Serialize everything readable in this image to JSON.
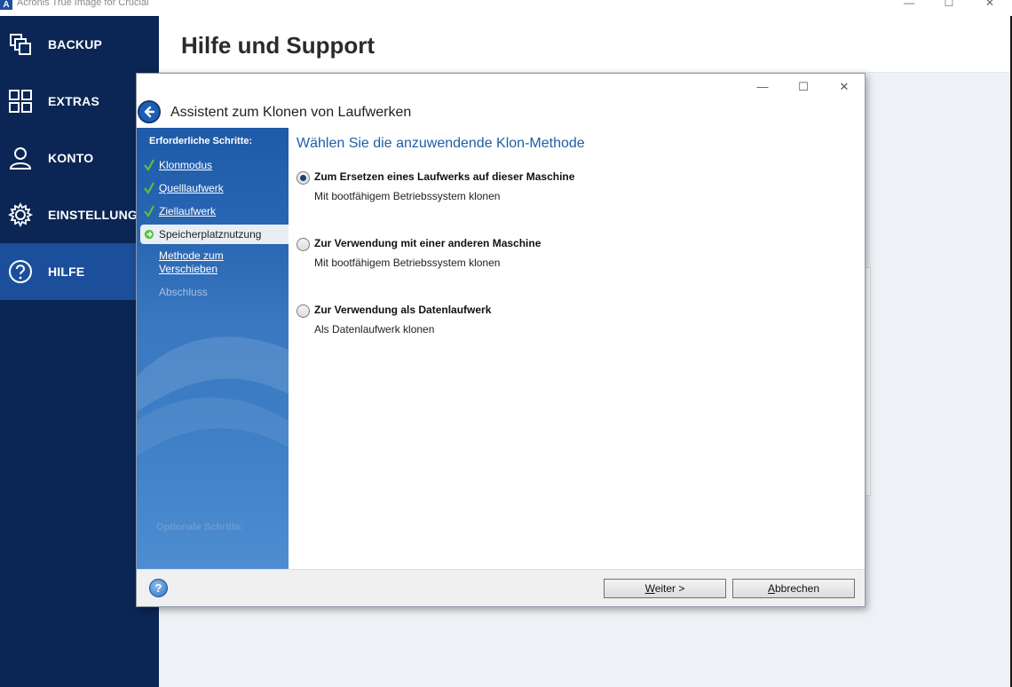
{
  "app": {
    "title": "Acronis True Image for Crucial",
    "logo_letter": "A",
    "controls": {
      "minimize": "—",
      "maximize": "☐",
      "close": "✕"
    }
  },
  "sidebar": {
    "items": [
      {
        "label": "BACKUP",
        "icon": "backup-icon",
        "active": false
      },
      {
        "label": "EXTRAS",
        "icon": "extras-grid-icon",
        "active": false
      },
      {
        "label": "KONTO",
        "icon": "user-icon",
        "active": false
      },
      {
        "label": "EINSTELLUNGEN",
        "icon": "gear-icon",
        "active": false
      },
      {
        "label": "HILFE",
        "icon": "help-icon",
        "active": true
      }
    ]
  },
  "main": {
    "title": "Hilfe und Support"
  },
  "wizard": {
    "title": "Assistent zum Klonen von Laufwerken",
    "controls": {
      "minimize": "—",
      "maximize": "☐",
      "close": "✕"
    },
    "steps_heading": "Erforderliche Schritte:",
    "steps": [
      {
        "label": "Klonmodus",
        "state": "done"
      },
      {
        "label": "Quelllaufwerk",
        "state": "done"
      },
      {
        "label": "Ziellaufwerk",
        "state": "done"
      },
      {
        "label": "Speicherplatznutzung",
        "state": "current"
      },
      {
        "label": "Methode zum Verschieben",
        "line1": "Methode zum",
        "line2": "Verschieben",
        "state": "pending"
      },
      {
        "label": "Abschluss",
        "state": "disabled"
      }
    ],
    "optional_heading": "Optionale Schritte:",
    "content_heading": "Wählen Sie die anzuwendende Klon-Methode",
    "options": [
      {
        "title": "Zum Ersetzen eines Laufwerks auf dieser Maschine",
        "subtitle": "Mit bootfähigem Betriebssystem klonen",
        "selected": true
      },
      {
        "title": "Zur Verwendung mit einer anderen Maschine",
        "subtitle": "Mit bootfähigem Betriebssystem klonen",
        "selected": false
      },
      {
        "title": "Zur Verwendung als Datenlaufwerk",
        "subtitle": "Als Datenlaufwerk klonen",
        "selected": false
      }
    ],
    "buttons": {
      "next": {
        "accel": "W",
        "rest": "eiter >"
      },
      "cancel": {
        "accel": "A",
        "rest": "bbrechen"
      }
    },
    "help_glyph": "?"
  },
  "colors": {
    "sidebar_bg": "#0b2654",
    "sidebar_active": "#1b4f9c",
    "heading_blue": "#1d5fa8",
    "check_green": "#58c23a"
  }
}
